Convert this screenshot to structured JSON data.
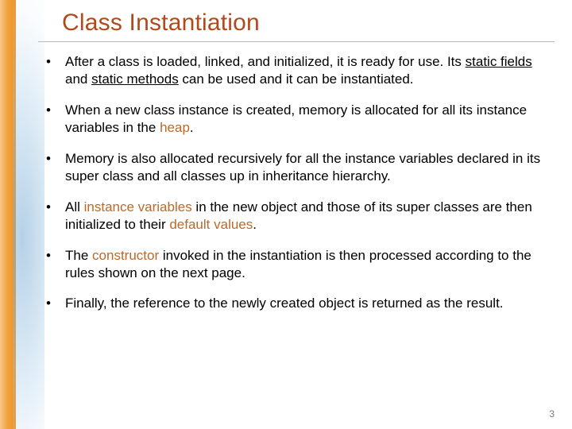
{
  "title": "Class Instantiation",
  "bullets": {
    "b1a": "After a class is loaded, linked, and initialized, it is ready for use.  Its ",
    "b1_static_fields": "static fields",
    "b1b": " and ",
    "b1_static_methods": "static methods",
    "b1c": " can be used and it can be instantiated.",
    "b2a": "When a new class instance is created, memory is allocated for all its instance variables in the ",
    "b2_heap": "heap",
    "b2b": ".",
    "b3": "Memory is also allocated recursively for all the instance variables declared in its super class and all classes up in  inheritance hierarchy.",
    "b4a": "All ",
    "b4_iv": "instance variables",
    "b4b": " in the new object and those of its super classes are then initialized to their ",
    "b4_dv": "default values",
    "b4c": ".",
    "b5a": "The ",
    "b5_ctor": "constructor",
    "b5b": " invoked in the instantiation is then processed according to the rules shown on the next page.",
    "b6": "Finally, the reference to the newly created object is returned as the result."
  },
  "page_number": "3"
}
